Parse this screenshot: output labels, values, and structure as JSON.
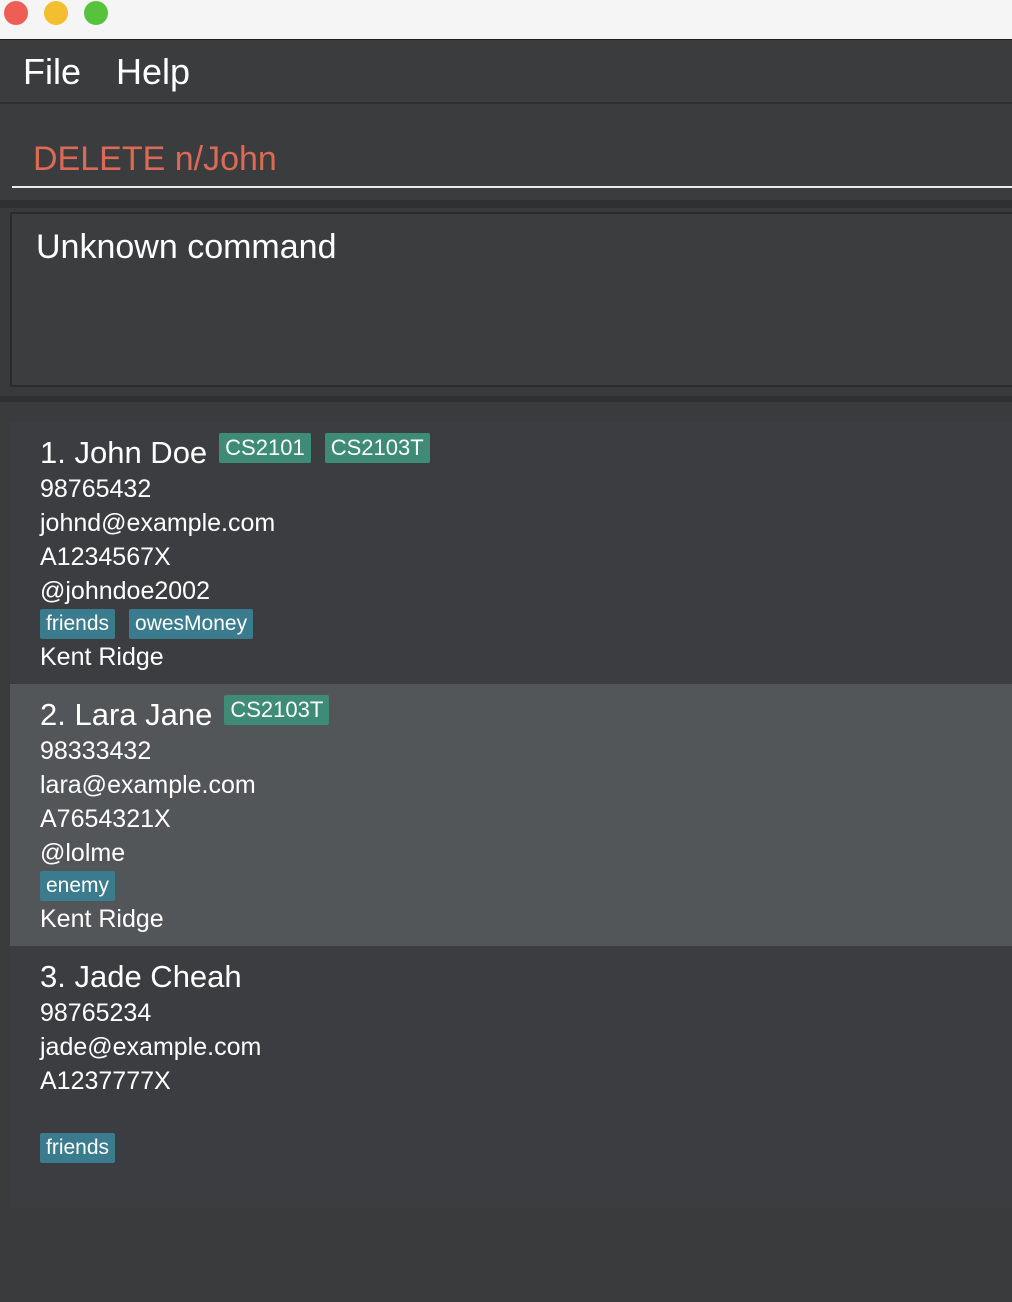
{
  "menu": {
    "file": "File",
    "help": "Help"
  },
  "command": {
    "value": "DELETE n/John"
  },
  "result": {
    "text": "Unknown command"
  },
  "persons": [
    {
      "name": "1. John Doe",
      "modules": [
        "CS2101",
        "CS2103T"
      ],
      "phone": "98765432",
      "email": "johnd@example.com",
      "student_id": "A1234567X",
      "telegram": "@johndoe2002",
      "tags": [
        "friends",
        "owesMoney"
      ],
      "address": "Kent Ridge"
    },
    {
      "name": "2. Lara Jane",
      "modules": [
        "CS2103T"
      ],
      "phone": "98333432",
      "email": "lara@example.com",
      "student_id": "A7654321X",
      "telegram": "@lolme",
      "tags": [
        "enemy"
      ],
      "address": "Kent Ridge"
    },
    {
      "name": "3. Jade Cheah",
      "phone": "98765234",
      "email": "jade@example.com",
      "student_id": "A1237777X",
      "tags": [
        "friends"
      ]
    }
  ],
  "colors": {
    "command_text": "#dc6a56",
    "module_badge": "#3e8c78",
    "tag_badge": "#3a7b8d",
    "selected_card": "#535659"
  }
}
